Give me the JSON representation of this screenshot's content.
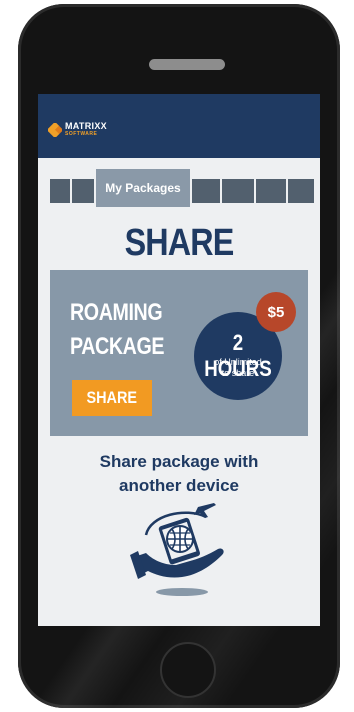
{
  "header": {
    "logo_name": "MATRIXX",
    "logo_sub": "SOFTWARE"
  },
  "tabs": {
    "active_label": "My Packages"
  },
  "page": {
    "title": "SHARE"
  },
  "package": {
    "title_line1": "ROAMING",
    "title_line2": "PACKAGE",
    "share_label": "SHARE",
    "price": "$5",
    "hours_value": "2 HOURS",
    "hours_sub1": "of Unlimited",
    "hours_sub2": "to share"
  },
  "description": {
    "line1": "Share package with",
    "line2": "another device"
  },
  "colors": {
    "navy": "#1f3a62",
    "card": "#8798a8",
    "orange": "#f29a22",
    "badge": "#b7472a"
  },
  "icons": {
    "illustration": "hand-phone-globe-icon"
  }
}
